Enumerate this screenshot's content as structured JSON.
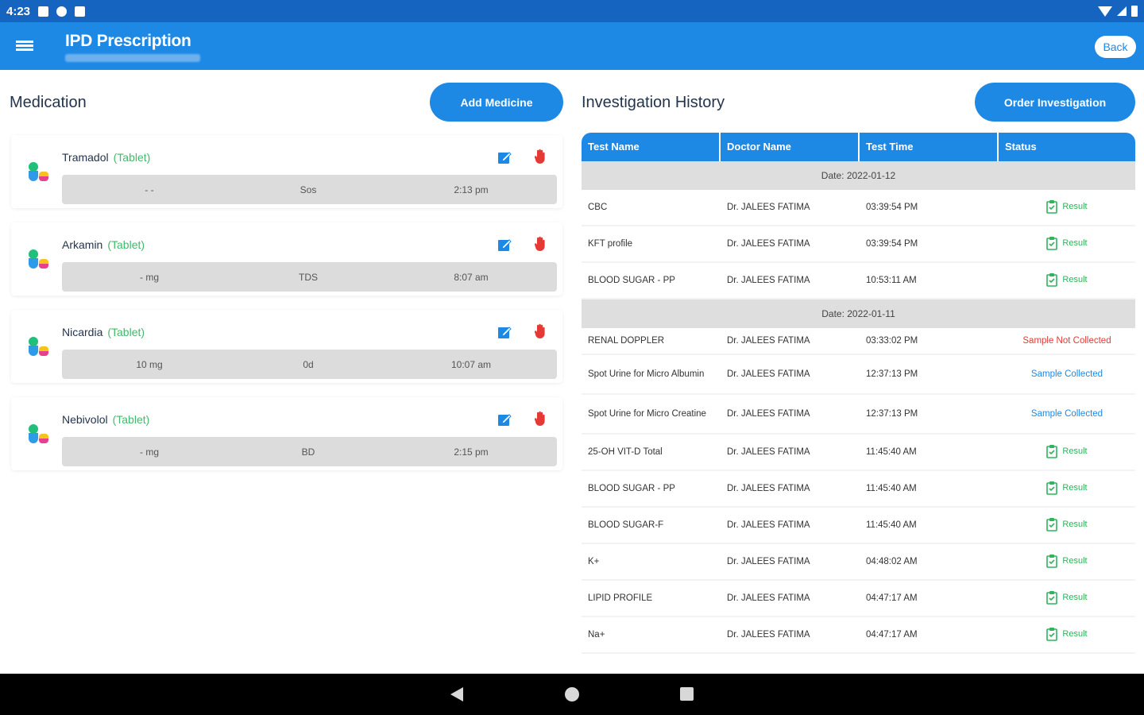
{
  "status_bar": {
    "time": "4:23"
  },
  "app_bar": {
    "title": "IPD Prescription",
    "back_label": "Back"
  },
  "medication": {
    "title": "Medication",
    "add_button": "Add Medicine",
    "items": [
      {
        "name": "Tramadol",
        "type": "(Tablet)",
        "dose": "- -",
        "freq": "Sos",
        "time": "2:13 pm"
      },
      {
        "name": "Arkamin",
        "type": "(Tablet)",
        "dose": "- mg",
        "freq": "TDS",
        "time": "8:07 am"
      },
      {
        "name": "Nicardia",
        "type": "(Tablet)",
        "dose": "10 mg",
        "freq": "0d",
        "time": "10:07 am"
      },
      {
        "name": "Nebivolol",
        "type": "(Tablet)",
        "dose": "- mg",
        "freq": "BD",
        "time": "2:15 pm"
      }
    ]
  },
  "investigation": {
    "title": "Investigation History",
    "order_button": "Order Investigation",
    "headers": [
      "Test Name",
      "Doctor Name",
      "Test Time",
      "Status"
    ],
    "groups": [
      {
        "date": "Date: 2022-01-12",
        "rows": [
          {
            "test": "CBC",
            "doctor": "Dr. JALEES FATIMA",
            "time": "03:39:54 PM",
            "status": "Result"
          },
          {
            "test": "KFT profile",
            "doctor": "Dr. JALEES FATIMA",
            "time": "03:39:54 PM",
            "status": "Result"
          },
          {
            "test": "BLOOD SUGAR - PP",
            "doctor": "Dr. JALEES FATIMA",
            "time": "10:53:11 AM",
            "status": "Result"
          }
        ]
      },
      {
        "date": "Date: 2022-01-11",
        "rows": [
          {
            "test": "RENAL DOPPLER",
            "doctor": "Dr. JALEES FATIMA",
            "time": "03:33:02 PM",
            "status": "Sample Not Collected"
          },
          {
            "test": "Spot Urine for Micro Albumin",
            "doctor": "Dr. JALEES FATIMA",
            "time": "12:37:13 PM",
            "status": "Sample Collected"
          },
          {
            "test": "Spot Urine for Micro Creatine",
            "doctor": "Dr. JALEES FATIMA",
            "time": "12:37:13 PM",
            "status": "Sample Collected"
          },
          {
            "test": "25-OH VIT-D Total",
            "doctor": "Dr. JALEES FATIMA",
            "time": "11:45:40 AM",
            "status": "Result"
          },
          {
            "test": "BLOOD SUGAR - PP",
            "doctor": "Dr. JALEES FATIMA",
            "time": "11:45:40 AM",
            "status": "Result"
          },
          {
            "test": "BLOOD SUGAR-F",
            "doctor": "Dr. JALEES FATIMA",
            "time": "11:45:40 AM",
            "status": "Result"
          },
          {
            "test": "K+",
            "doctor": "Dr. JALEES FATIMA",
            "time": "04:48:02 AM",
            "status": "Result"
          },
          {
            "test": "LIPID PROFILE",
            "doctor": "Dr. JALEES FATIMA",
            "time": "04:47:17 AM",
            "status": "Result"
          },
          {
            "test": "Na+",
            "doctor": "Dr. JALEES FATIMA",
            "time": "04:47:17 AM",
            "status": "Result"
          }
        ]
      }
    ]
  },
  "colors": {
    "primary": "#1e88e5",
    "status_bar": "#1565c0",
    "result_green": "#2fb35c",
    "not_collected_red": "#e53935"
  }
}
